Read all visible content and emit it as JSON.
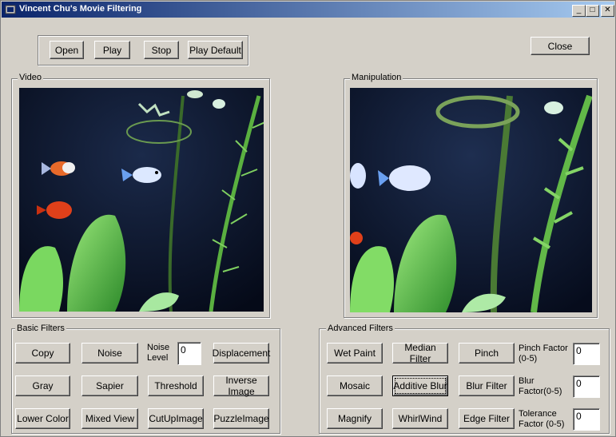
{
  "window": {
    "title": "Vincent Chu's Movie Filtering",
    "controls": {
      "minimize": "_",
      "maximize": "□",
      "close": "✕"
    }
  },
  "toolbar": {
    "open": "Open",
    "play": "Play",
    "stop": "Stop",
    "play_default": "Play Default"
  },
  "close_button": "Close",
  "video_group": {
    "label": "Video"
  },
  "manipulation_group": {
    "label": "Manipulation"
  },
  "basic_filters": {
    "label": "Basic Filters",
    "buttons": [
      "Copy",
      "Noise",
      "Displacement",
      "Gray",
      "Sapier",
      "Threshold",
      "Inverse Image",
      "Lower Color",
      "Mixed View",
      "CutUpImage",
      "PuzzleImage"
    ],
    "noise_level_label": "Noise Level",
    "noise_level_value": "0"
  },
  "advanced_filters": {
    "label": "Advanced Filters",
    "buttons": [
      "Wet Paint",
      "Median Filter",
      "Pinch",
      "Mosaic",
      "Additive Blur",
      "Blur Filter",
      "Magnify",
      "WhirlWind",
      "Edge Filter"
    ],
    "pinch_factor_label": "Pinch Factor (0-5)",
    "pinch_factor_value": "0",
    "blur_factor_label": "Blur Factor(0-5)",
    "blur_factor_value": "0",
    "tolerance_factor_label": "Tolerance Factor (0-5)",
    "tolerance_factor_value": "0"
  },
  "colors": {
    "titlebar_start": "#0a246a",
    "titlebar_end": "#a6caf0",
    "face": "#d4d0c8"
  }
}
